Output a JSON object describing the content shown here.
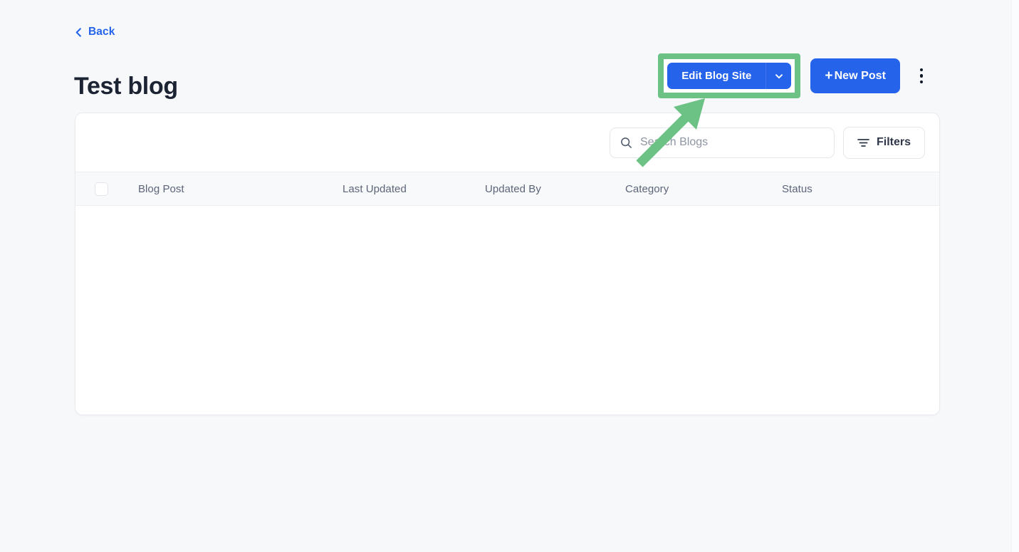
{
  "colors": {
    "accent": "#2563eb",
    "highlight": "#6cc184",
    "page_background": "#f7f8fa",
    "card_background": "#ffffff",
    "title_text": "#1c2333",
    "muted_text": "#5c6578"
  },
  "nav": {
    "back_label": "Back",
    "back_icon": "chevron-left-icon"
  },
  "header": {
    "title": "Test blog",
    "edit_blog_site_label": "Edit Blog Site",
    "edit_blog_site_caret_icon": "chevron-down-icon",
    "new_post_label": "New Post",
    "new_post_plus": "+",
    "overflow_icon": "kebab-menu-icon"
  },
  "toolbar": {
    "search_placeholder": "Search Blogs",
    "search_value": "",
    "search_icon": "search-icon",
    "filters_label": "Filters",
    "filters_icon": "filter-icon"
  },
  "table": {
    "select_all_checked": false,
    "columns": [
      "Blog Post",
      "Last Updated",
      "Updated By",
      "Category",
      "Status"
    ],
    "rows": []
  },
  "annotation": {
    "arrow_color": "#6cc184",
    "arrow_direction": "up-right",
    "highlight_target": "Edit Blog Site"
  }
}
